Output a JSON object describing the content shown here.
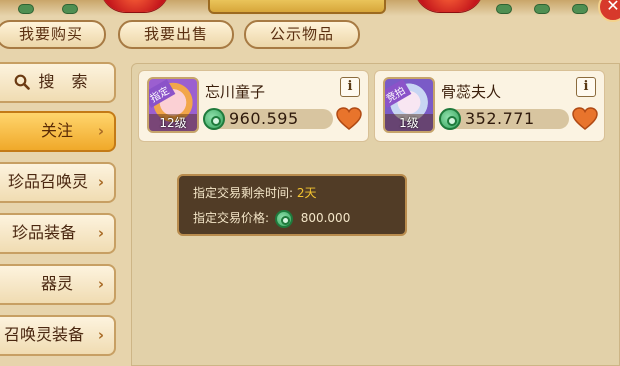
{
  "window": {
    "title": ""
  },
  "top_tabs": [
    {
      "label": "我要购买"
    },
    {
      "label": "我要出售"
    },
    {
      "label": "公示物品"
    }
  ],
  "sidebar": {
    "search_label": "搜 索",
    "items": [
      {
        "label": "关注",
        "active": true
      },
      {
        "label": "珍品召唤灵",
        "active": false
      },
      {
        "label": "珍品装备",
        "active": false
      },
      {
        "label": "器灵",
        "active": false
      },
      {
        "label": "召唤灵装备",
        "active": false
      }
    ]
  },
  "listings": [
    {
      "badge": "指定",
      "badge_color": "#8b53c9",
      "level": "12级",
      "name": "忘川童子",
      "price": "960.595",
      "avatar_icon": "pig-pet-icon"
    },
    {
      "badge": "竞拍",
      "badge_color": "#8b53c9",
      "level": "1级",
      "name": "骨蕊夫人",
      "price": "352.771",
      "avatar_icon": "lady-pet-icon"
    }
  ],
  "tooltip": {
    "time_label": "指定交易剩余时间:",
    "time_value": "2天",
    "price_label": "指定交易价格:",
    "price_value": "800.000"
  },
  "colors": {
    "accent": "#f0a92a",
    "heart": "#e8742c",
    "coin": "#35a35c",
    "highlight_text": "#f4c430"
  }
}
